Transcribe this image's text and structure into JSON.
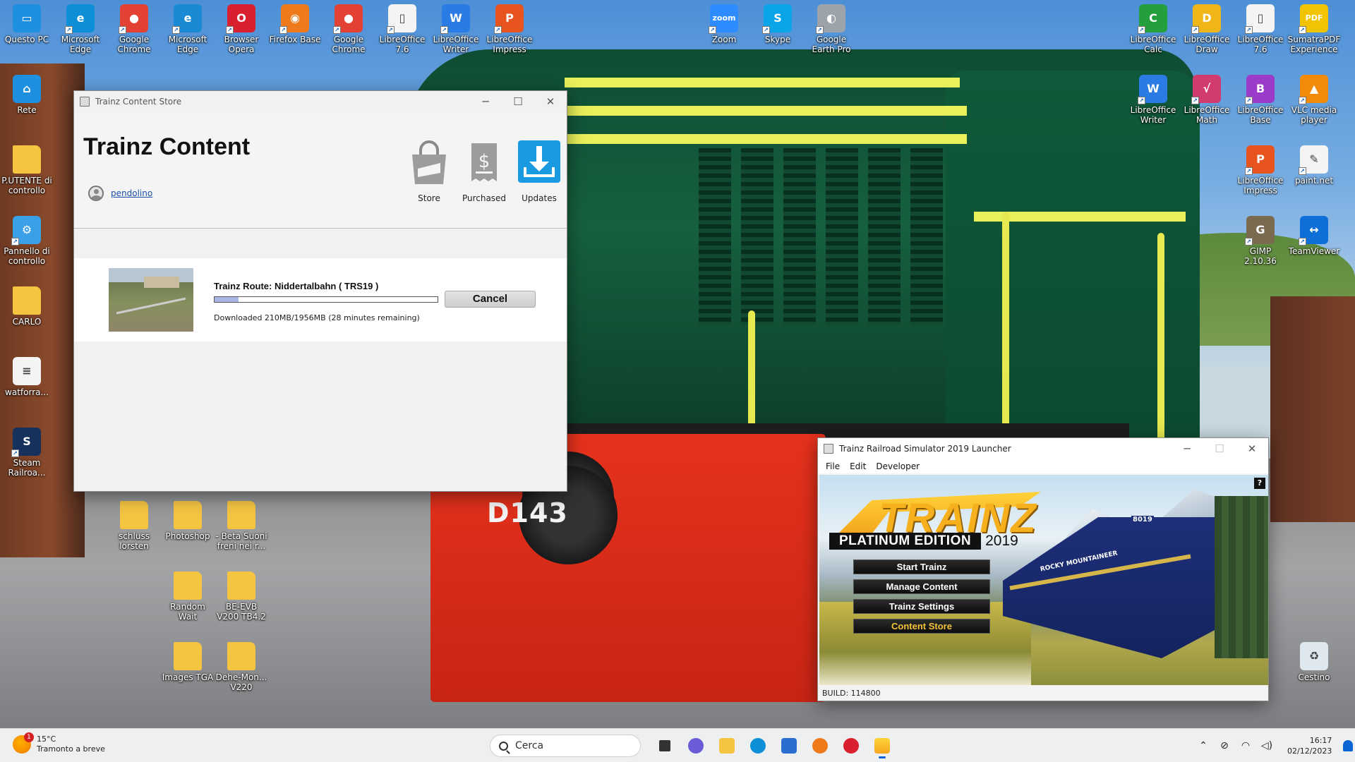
{
  "desktop": {
    "icons": [
      {
        "id": "questo-pc",
        "label": "Questo PC",
        "color": "#1f8fe0",
        "glyph": "▭"
      },
      {
        "id": "rete",
        "label": "Rete",
        "color": "#1f8fe0",
        "glyph": "⌂"
      },
      {
        "id": "p-utente-controllo",
        "label": "P.UTENTE di controllo",
        "color": "#f5c542",
        "glyph": ""
      },
      {
        "id": "pannello-controllo",
        "label": "Pannello di controllo",
        "color": "#3aa0e8",
        "glyph": "⚙"
      },
      {
        "id": "carlo",
        "label": "CARLO",
        "color": "#f5c542",
        "glyph": ""
      },
      {
        "id": "watfor",
        "label": "watforra...",
        "color": "#f4f4f4",
        "glyph": "≡"
      },
      {
        "id": "steam",
        "label": "Steam Railroa...",
        "color": "#16325c",
        "glyph": "S"
      },
      {
        "id": "ms-edge",
        "label": "Microsoft Edge",
        "color": "#0c8fd6",
        "glyph": "e"
      },
      {
        "id": "google-chrome",
        "label": "Google Chrome",
        "color": "#e34133",
        "glyph": "●"
      },
      {
        "id": "ms-edge-2",
        "label": "Microsoft Edge",
        "color": "#1a8ad4",
        "glyph": "e"
      },
      {
        "id": "browser-opera",
        "label": "Browser Opera",
        "color": "#d8202f",
        "glyph": "O"
      },
      {
        "id": "firefox-base",
        "label": "Firefox Base",
        "color": "#ef7a1c",
        "glyph": "◉"
      },
      {
        "id": "google-chrome-2",
        "label": "Google Chrome",
        "color": "#e34133",
        "glyph": "●"
      },
      {
        "id": "libreoffice-76",
        "label": "LibreOffice 7.6",
        "color": "#f4f4f4",
        "glyph": "▯"
      },
      {
        "id": "libreoffice-writer",
        "label": "LibreOffice Writer",
        "color": "#2a7be4",
        "glyph": "W"
      },
      {
        "id": "libreoffice-impress",
        "label": "LibreOffice Impress",
        "color": "#e7541f",
        "glyph": "P"
      },
      {
        "id": "zoom",
        "label": "Zoom",
        "color": "#2d8cff",
        "glyph": "zoom"
      },
      {
        "id": "skype",
        "label": "Skype",
        "color": "#0aa4e8",
        "glyph": "S"
      },
      {
        "id": "google-earth-pro",
        "label": "Google Earth Pro",
        "color": "#9ca3ab",
        "glyph": "◐"
      },
      {
        "id": "libreoffice-calc",
        "label": "LibreOffice Calc",
        "color": "#23a03d",
        "glyph": "C"
      },
      {
        "id": "libreoffice-draw",
        "label": "LibreOffice Draw",
        "color": "#f0b618",
        "glyph": "D"
      },
      {
        "id": "libreoffice-76-2",
        "label": "LibreOffice 7.6",
        "color": "#f4f4f4",
        "glyph": "▯"
      },
      {
        "id": "sumatra-pdf",
        "label": "SumatraPDF Experience",
        "color": "#f2c300",
        "glyph": "PDF"
      },
      {
        "id": "libreoffice-writer-2",
        "label": "LibreOffice Writer",
        "color": "#2a7be4",
        "glyph": "W"
      },
      {
        "id": "libreoffice-math",
        "label": "LibreOffice Math",
        "color": "#d23b6e",
        "glyph": "√"
      },
      {
        "id": "libreoffice-base",
        "label": "LibreOffice Base",
        "color": "#9c3bc9",
        "glyph": "B"
      },
      {
        "id": "vlc",
        "label": "VLC media player",
        "color": "#f28a0a",
        "glyph": "▲"
      },
      {
        "id": "libreoffice-impress-2",
        "label": "LibreOffice Impress",
        "color": "#e7541f",
        "glyph": "P"
      },
      {
        "id": "paintnet",
        "label": "paint.net",
        "color": "#f4f4f4",
        "glyph": "✎"
      },
      {
        "id": "gimp",
        "label": "GIMP 2.10.36",
        "color": "#7a6a4f",
        "glyph": "G"
      },
      {
        "id": "teamviewer",
        "label": "TeamViewer",
        "color": "#0e6fd8",
        "glyph": "↔"
      },
      {
        "id": "schluss-lorsten",
        "label": "schluss lorsten",
        "color": "#f5c542",
        "glyph": ""
      },
      {
        "id": "photoshop",
        "label": "Photoshop",
        "color": "#f5c542",
        "glyph": ""
      },
      {
        "id": "beta-suoni",
        "label": "- Beta Suoni freni nei r...",
        "color": "#f5c542",
        "glyph": ""
      },
      {
        "id": "random-wait",
        "label": "Random Wait",
        "color": "#f5c542",
        "glyph": ""
      },
      {
        "id": "be-evb-v200",
        "label": "BE-EVB V200 TB4.2",
        "color": "#f5c542",
        "glyph": ""
      },
      {
        "id": "images-tga",
        "label": "Images TGA",
        "color": "#f5c542",
        "glyph": ""
      },
      {
        "id": "dehe-mon-v220",
        "label": "Dehe-Mon... V220",
        "color": "#f5c542",
        "glyph": ""
      },
      {
        "id": "cestino",
        "label": "Cestino",
        "color": "#dfe8ef",
        "glyph": "♻"
      }
    ]
  },
  "content_store": {
    "window_title": "Trainz Content Store",
    "heading": "Trainz Content",
    "username": "pendolino",
    "nav": {
      "store": "Store",
      "purchased": "Purchased",
      "updates": "Updates"
    },
    "download": {
      "title": "Trainz Route: Niddertalbahn ( TRS19 )",
      "progress_fraction": 0.107,
      "cancel_label": "Cancel",
      "status": "Downloaded 210MB/1956MB (28 minutes remaining)"
    }
  },
  "launcher": {
    "window_title": "Trainz Railroad Simulator 2019 Launcher",
    "menu": [
      "File",
      "Edit",
      "Developer"
    ],
    "help": "?",
    "logo": "TRAINZ",
    "edition": "PLATINUM EDITION",
    "year": "2019",
    "buttons": {
      "start": "Start Trainz",
      "manage": "Manage Content",
      "settings": "Trainz Settings",
      "store": "Content Store"
    },
    "build": "BUILD: 114800",
    "art_texts": {
      "locomotive_number": "8019",
      "livery": "ROCKY MOUNTAINEER"
    }
  },
  "wallpaper": {
    "locomotive_number": "D143"
  },
  "taskbar": {
    "weather_temp": "15°C",
    "weather_desc": "Tramonto a breve",
    "weather_badge": "1",
    "search_placeholder": "Cerca",
    "time": "16:17",
    "date": "02/12/2023"
  }
}
